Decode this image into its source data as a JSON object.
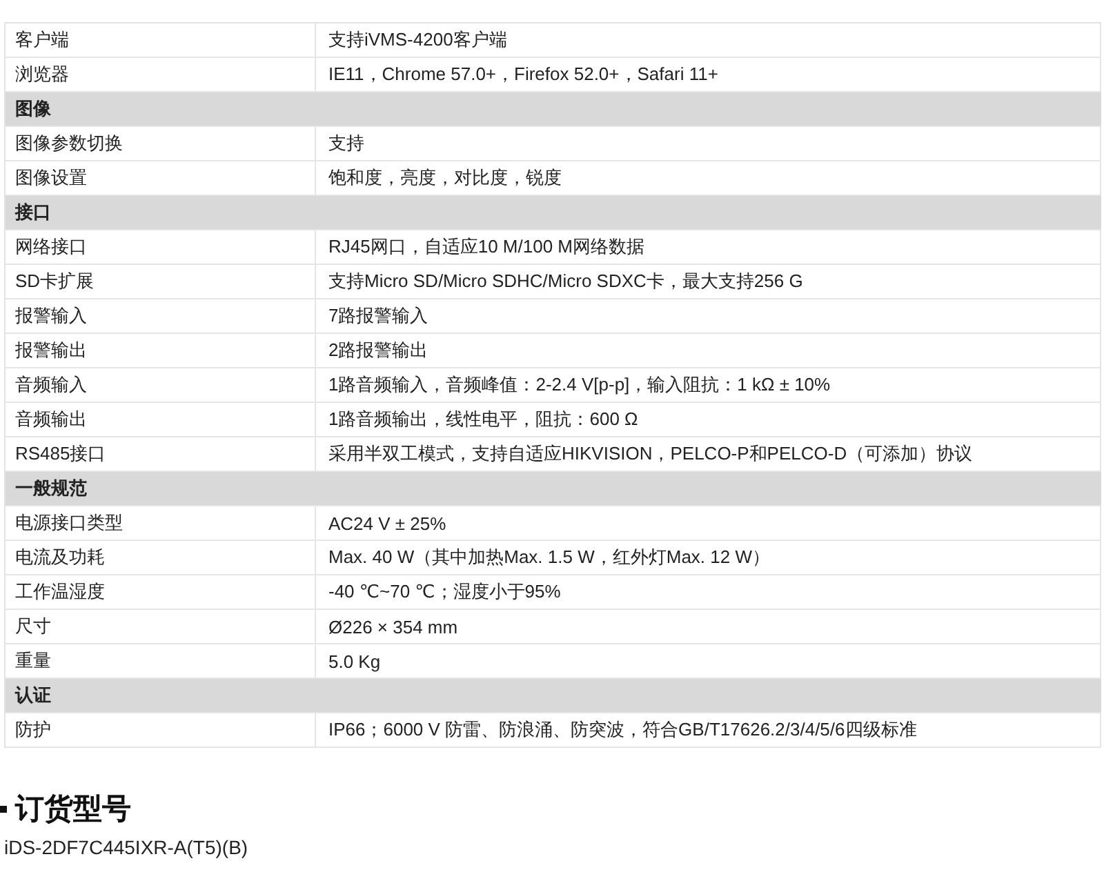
{
  "spec_table": {
    "rows": [
      {
        "kind": "spec",
        "label": "客户端",
        "value": "支持iVMS-4200客户端"
      },
      {
        "kind": "spec",
        "label": "浏览器",
        "value": "IE11，Chrome 57.0+，Firefox 52.0+，Safari 11+"
      },
      {
        "kind": "section",
        "label": "图像"
      },
      {
        "kind": "spec",
        "label": "图像参数切换",
        "value": "支持"
      },
      {
        "kind": "spec",
        "label": "图像设置",
        "value": "饱和度，亮度，对比度，锐度"
      },
      {
        "kind": "section",
        "label": "接口"
      },
      {
        "kind": "spec",
        "label": "网络接口",
        "value": "RJ45网口，自适应10 M/100 M网络数据"
      },
      {
        "kind": "spec",
        "label": "SD卡扩展",
        "value": "支持Micro SD/Micro SDHC/Micro SDXC卡，最大支持256 G"
      },
      {
        "kind": "spec",
        "label": "报警输入",
        "value": "7路报警输入"
      },
      {
        "kind": "spec",
        "label": "报警输出",
        "value": "2路报警输出"
      },
      {
        "kind": "spec",
        "label": "音频输入",
        "value": "1路音频输入，音频峰值：2-2.4 V[p-p]，输入阻抗：1 kΩ ± 10%"
      },
      {
        "kind": "spec",
        "label": "音频输出",
        "value": "1路音频输出，线性电平，阻抗：600 Ω"
      },
      {
        "kind": "spec",
        "label": "RS485接口",
        "value": "采用半双工模式，支持自适应HIKVISION，PELCO-P和PELCO-D（可添加）协议"
      },
      {
        "kind": "section",
        "label": "一般规范"
      },
      {
        "kind": "spec",
        "label": "电源接口类型",
        "value": "AC24 V ± 25%"
      },
      {
        "kind": "spec",
        "label": "电流及功耗",
        "value": "Max. 40 W（其中加热Max. 1.5 W，红外灯Max. 12 W）"
      },
      {
        "kind": "spec",
        "label": "工作温湿度",
        "value": "-40 ℃~70 ℃；湿度小于95%"
      },
      {
        "kind": "spec",
        "label": "尺寸",
        "value": "Ø226 × 354 mm"
      },
      {
        "kind": "spec",
        "label": "重量",
        "value": "5.0 Kg"
      },
      {
        "kind": "section",
        "label": "认证"
      },
      {
        "kind": "spec",
        "label": "防护",
        "value": "IP66；6000 V 防雷、防浪涌、防突波，符合GB/T17626.2/3/4/5/6四级标准"
      }
    ]
  },
  "order_section": {
    "heading": "订货型号",
    "model": "iDS-2DF7C445IXR-A(T5)(B)"
  }
}
